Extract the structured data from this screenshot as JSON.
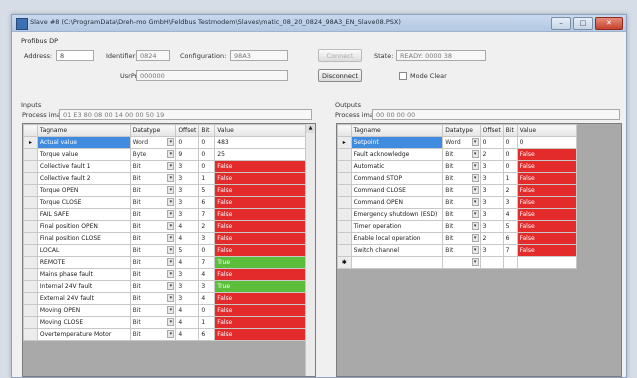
{
  "window": {
    "title": "Slave #8 (C:\\ProgramData\\Dreh-mo GmbH\\Feldbus Testmodem\\Slaves\\matic_08_20_0824_98A3_EN_Slave08.PSX)",
    "min_label": "–",
    "max_label": "□",
    "close_label": "✕"
  },
  "header": {
    "group_label": "Profibus DP",
    "address_label": "Address:",
    "address_value": "8",
    "ident_label": "Identifier:",
    "ident_value": "0824",
    "config_label": "Configuration:",
    "config_value": "98A3",
    "userprm_label": "UsrPrm:",
    "userprm_value": "000000",
    "connect_label": "Connect",
    "disconnect_label": "Disconnect",
    "state_label": "State:",
    "state_value": "READY: 0000 38",
    "mode_clear_label": "Mode Clear"
  },
  "inputs": {
    "section_label": "Inputs",
    "process_image_label": "Process image:",
    "process_image_value": "01 E3 80 08 00 14 00 00 50 19",
    "columns": [
      "Tagname",
      "Datatype",
      "Offset",
      "Bit",
      "Value"
    ],
    "rows": [
      {
        "marker": "▸",
        "tag": "Actual value",
        "type": "Word",
        "offset": "0",
        "bit": "0",
        "value": "483",
        "state": "normal",
        "selected": true
      },
      {
        "marker": "",
        "tag": "Torque value",
        "type": "Byte",
        "offset": "9",
        "bit": "0",
        "value": "25",
        "state": "normal",
        "selected": false
      },
      {
        "marker": "",
        "tag": "Collective fault 1",
        "type": "Bit",
        "offset": "3",
        "bit": "0",
        "value": "False",
        "state": "false",
        "selected": false
      },
      {
        "marker": "",
        "tag": "Collective fault 2",
        "type": "Bit",
        "offset": "3",
        "bit": "1",
        "value": "False",
        "state": "false",
        "selected": false
      },
      {
        "marker": "",
        "tag": "Torque OPEN",
        "type": "Bit",
        "offset": "3",
        "bit": "5",
        "value": "False",
        "state": "false",
        "selected": false
      },
      {
        "marker": "",
        "tag": "Torque CLOSE",
        "type": "Bit",
        "offset": "3",
        "bit": "6",
        "value": "False",
        "state": "false",
        "selected": false
      },
      {
        "marker": "",
        "tag": "FAIL SAFE",
        "type": "Bit",
        "offset": "3",
        "bit": "7",
        "value": "False",
        "state": "false",
        "selected": false
      },
      {
        "marker": "",
        "tag": "Final position OPEN",
        "type": "Bit",
        "offset": "4",
        "bit": "2",
        "value": "False",
        "state": "false",
        "selected": false
      },
      {
        "marker": "",
        "tag": "Final position CLOSE",
        "type": "Bit",
        "offset": "4",
        "bit": "3",
        "value": "False",
        "state": "false",
        "selected": false
      },
      {
        "marker": "",
        "tag": "LOCAL",
        "type": "Bit",
        "offset": "5",
        "bit": "0",
        "value": "False",
        "state": "false",
        "selected": false
      },
      {
        "marker": "",
        "tag": "REMOTE",
        "type": "Bit",
        "offset": "4",
        "bit": "7",
        "value": "True",
        "state": "true",
        "selected": false
      },
      {
        "marker": "",
        "tag": "Mains phase fault",
        "type": "Bit",
        "offset": "3",
        "bit": "4",
        "value": "False",
        "state": "false",
        "selected": false
      },
      {
        "marker": "",
        "tag": "Internal 24V fault",
        "type": "Bit",
        "offset": "3",
        "bit": "3",
        "value": "True",
        "state": "true",
        "selected": false
      },
      {
        "marker": "",
        "tag": "External 24V fault",
        "type": "Bit",
        "offset": "3",
        "bit": "4",
        "value": "False",
        "state": "false",
        "selected": false
      },
      {
        "marker": "",
        "tag": "Moving OPEN",
        "type": "Bit",
        "offset": "4",
        "bit": "0",
        "value": "False",
        "state": "false",
        "selected": false
      },
      {
        "marker": "",
        "tag": "Moving CLOSE",
        "type": "Bit",
        "offset": "4",
        "bit": "1",
        "value": "False",
        "state": "false",
        "selected": false
      },
      {
        "marker": "",
        "tag": "Overtemperature Motor",
        "type": "Bit",
        "offset": "4",
        "bit": "6",
        "value": "False",
        "state": "false",
        "selected": false
      }
    ]
  },
  "outputs": {
    "section_label": "Outputs",
    "process_image_label": "Process image:",
    "process_image_value": "00 00 00 00",
    "columns": [
      "Tagname",
      "Datatype",
      "Offset",
      "Bit",
      "Value"
    ],
    "rows": [
      {
        "marker": "▸",
        "tag": "Setpoint",
        "type": "Word",
        "offset": "0",
        "bit": "0",
        "value": "0",
        "state": "normal",
        "selected": true
      },
      {
        "marker": "",
        "tag": "Fault acknowledge",
        "type": "Bit",
        "offset": "2",
        "bit": "0",
        "value": "False",
        "state": "false",
        "selected": false
      },
      {
        "marker": "",
        "tag": "Automatic",
        "type": "Bit",
        "offset": "3",
        "bit": "0",
        "value": "False",
        "state": "false",
        "selected": false
      },
      {
        "marker": "",
        "tag": "Command STOP",
        "type": "Bit",
        "offset": "3",
        "bit": "1",
        "value": "False",
        "state": "false",
        "selected": false
      },
      {
        "marker": "",
        "tag": "Command CLOSE",
        "type": "Bit",
        "offset": "3",
        "bit": "2",
        "value": "False",
        "state": "false",
        "selected": false
      },
      {
        "marker": "",
        "tag": "Command OPEN",
        "type": "Bit",
        "offset": "3",
        "bit": "3",
        "value": "False",
        "state": "false",
        "selected": false
      },
      {
        "marker": "",
        "tag": "Emergency shutdown (ESD)",
        "type": "Bit",
        "offset": "3",
        "bit": "4",
        "value": "False",
        "state": "false",
        "selected": false
      },
      {
        "marker": "",
        "tag": "Timer operation",
        "type": "Bit",
        "offset": "3",
        "bit": "5",
        "value": "False",
        "state": "false",
        "selected": false
      },
      {
        "marker": "",
        "tag": "Enable local operation",
        "type": "Bit",
        "offset": "2",
        "bit": "6",
        "value": "False",
        "state": "false",
        "selected": false
      },
      {
        "marker": "",
        "tag": "Switch channel",
        "type": "Bit",
        "offset": "3",
        "bit": "7",
        "value": "False",
        "state": "false",
        "selected": false
      },
      {
        "marker": "✱",
        "tag": "",
        "type": "",
        "offset": "",
        "bit": "",
        "value": "",
        "state": "new",
        "selected": false
      }
    ]
  }
}
